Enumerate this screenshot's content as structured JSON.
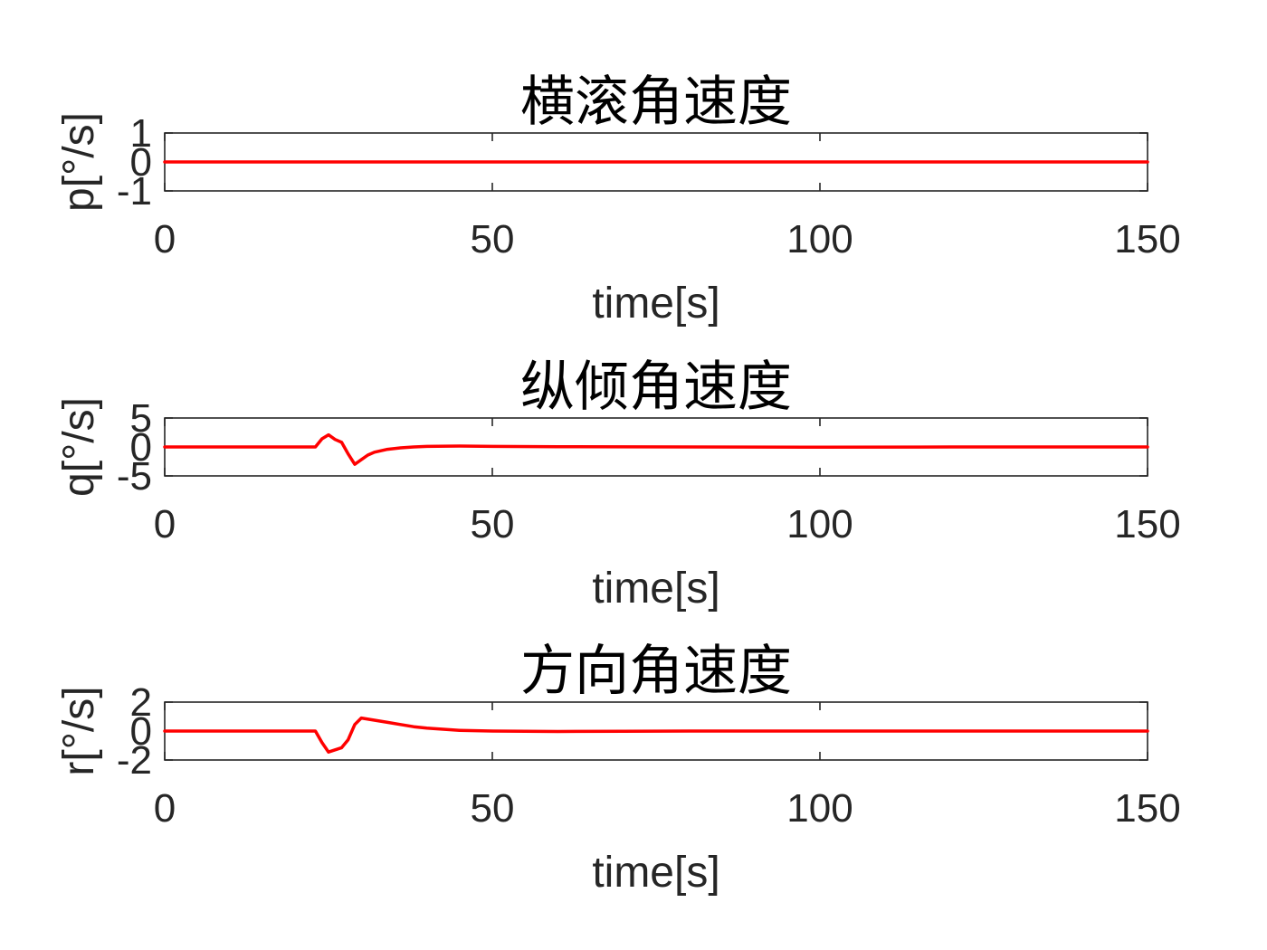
{
  "chart_data": [
    {
      "type": "line",
      "title": "横滚角速度",
      "xlabel": "time[s]",
      "ylabel": "p[°/s]",
      "xlim": [
        0,
        150
      ],
      "ylim": [
        -1,
        1
      ],
      "xticks": [
        0,
        50,
        100,
        150
      ],
      "yticks": [
        -1,
        0,
        1
      ],
      "series": [
        {
          "color": "#ff0000",
          "x": [
            0,
            150
          ],
          "y": [
            0,
            0
          ]
        }
      ]
    },
    {
      "type": "line",
      "title": "纵倾角速度",
      "xlabel": "time[s]",
      "ylabel": "q[°/s]",
      "xlim": [
        0,
        150
      ],
      "ylim": [
        -5,
        5
      ],
      "xticks": [
        0,
        50,
        100,
        150
      ],
      "yticks": [
        -5,
        0,
        5
      ],
      "series": [
        {
          "color": "#ff0000",
          "x": [
            0,
            23,
            24,
            25,
            26,
            27,
            28,
            29,
            30,
            31,
            32,
            34,
            36,
            38,
            40,
            45,
            50,
            60,
            80,
            100,
            120,
            150
          ],
          "y": [
            0,
            0,
            1.4,
            2.1,
            1.3,
            0.8,
            -1.2,
            -3.0,
            -2.2,
            -1.4,
            -0.9,
            -0.4,
            -0.15,
            0.0,
            0.1,
            0.15,
            0.1,
            0.05,
            0.0,
            -0.05,
            0.0,
            0.0
          ]
        }
      ]
    },
    {
      "type": "line",
      "title": "方向角速度",
      "xlabel": "time[s]",
      "ylabel": "r[°/s]",
      "xlim": [
        0,
        150
      ],
      "ylim": [
        -2,
        2
      ],
      "xticks": [
        0,
        50,
        100,
        150
      ],
      "yticks": [
        -2,
        0,
        2
      ],
      "series": [
        {
          "color": "#ff0000",
          "x": [
            0,
            23,
            24,
            25,
            26,
            27,
            28,
            29,
            30,
            32,
            34,
            36,
            38,
            40,
            45,
            50,
            55,
            60,
            70,
            80,
            100,
            120,
            150
          ],
          "y": [
            0,
            0,
            -0.8,
            -1.45,
            -1.3,
            -1.15,
            -0.6,
            0.45,
            0.9,
            0.75,
            0.6,
            0.45,
            0.3,
            0.2,
            0.05,
            0.0,
            -0.02,
            -0.03,
            -0.01,
            0.0,
            0.0,
            0.0,
            0.0
          ]
        }
      ]
    }
  ]
}
